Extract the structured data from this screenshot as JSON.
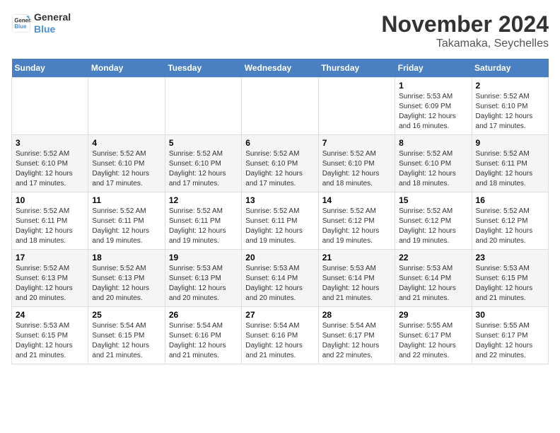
{
  "header": {
    "logo_line1": "General",
    "logo_line2": "Blue",
    "month_title": "November 2024",
    "location": "Takamaka, Seychelles"
  },
  "days_of_week": [
    "Sunday",
    "Monday",
    "Tuesday",
    "Wednesday",
    "Thursday",
    "Friday",
    "Saturday"
  ],
  "weeks": [
    [
      {
        "day": "",
        "info": ""
      },
      {
        "day": "",
        "info": ""
      },
      {
        "day": "",
        "info": ""
      },
      {
        "day": "",
        "info": ""
      },
      {
        "day": "",
        "info": ""
      },
      {
        "day": "1",
        "info": "Sunrise: 5:53 AM\nSunset: 6:09 PM\nDaylight: 12 hours and 16 minutes."
      },
      {
        "day": "2",
        "info": "Sunrise: 5:52 AM\nSunset: 6:10 PM\nDaylight: 12 hours and 17 minutes."
      }
    ],
    [
      {
        "day": "3",
        "info": "Sunrise: 5:52 AM\nSunset: 6:10 PM\nDaylight: 12 hours and 17 minutes."
      },
      {
        "day": "4",
        "info": "Sunrise: 5:52 AM\nSunset: 6:10 PM\nDaylight: 12 hours and 17 minutes."
      },
      {
        "day": "5",
        "info": "Sunrise: 5:52 AM\nSunset: 6:10 PM\nDaylight: 12 hours and 17 minutes."
      },
      {
        "day": "6",
        "info": "Sunrise: 5:52 AM\nSunset: 6:10 PM\nDaylight: 12 hours and 17 minutes."
      },
      {
        "day": "7",
        "info": "Sunrise: 5:52 AM\nSunset: 6:10 PM\nDaylight: 12 hours and 18 minutes."
      },
      {
        "day": "8",
        "info": "Sunrise: 5:52 AM\nSunset: 6:10 PM\nDaylight: 12 hours and 18 minutes."
      },
      {
        "day": "9",
        "info": "Sunrise: 5:52 AM\nSunset: 6:11 PM\nDaylight: 12 hours and 18 minutes."
      }
    ],
    [
      {
        "day": "10",
        "info": "Sunrise: 5:52 AM\nSunset: 6:11 PM\nDaylight: 12 hours and 18 minutes."
      },
      {
        "day": "11",
        "info": "Sunrise: 5:52 AM\nSunset: 6:11 PM\nDaylight: 12 hours and 19 minutes."
      },
      {
        "day": "12",
        "info": "Sunrise: 5:52 AM\nSunset: 6:11 PM\nDaylight: 12 hours and 19 minutes."
      },
      {
        "day": "13",
        "info": "Sunrise: 5:52 AM\nSunset: 6:11 PM\nDaylight: 12 hours and 19 minutes."
      },
      {
        "day": "14",
        "info": "Sunrise: 5:52 AM\nSunset: 6:12 PM\nDaylight: 12 hours and 19 minutes."
      },
      {
        "day": "15",
        "info": "Sunrise: 5:52 AM\nSunset: 6:12 PM\nDaylight: 12 hours and 19 minutes."
      },
      {
        "day": "16",
        "info": "Sunrise: 5:52 AM\nSunset: 6:12 PM\nDaylight: 12 hours and 20 minutes."
      }
    ],
    [
      {
        "day": "17",
        "info": "Sunrise: 5:52 AM\nSunset: 6:13 PM\nDaylight: 12 hours and 20 minutes."
      },
      {
        "day": "18",
        "info": "Sunrise: 5:52 AM\nSunset: 6:13 PM\nDaylight: 12 hours and 20 minutes."
      },
      {
        "day": "19",
        "info": "Sunrise: 5:53 AM\nSunset: 6:13 PM\nDaylight: 12 hours and 20 minutes."
      },
      {
        "day": "20",
        "info": "Sunrise: 5:53 AM\nSunset: 6:14 PM\nDaylight: 12 hours and 20 minutes."
      },
      {
        "day": "21",
        "info": "Sunrise: 5:53 AM\nSunset: 6:14 PM\nDaylight: 12 hours and 21 minutes."
      },
      {
        "day": "22",
        "info": "Sunrise: 5:53 AM\nSunset: 6:14 PM\nDaylight: 12 hours and 21 minutes."
      },
      {
        "day": "23",
        "info": "Sunrise: 5:53 AM\nSunset: 6:15 PM\nDaylight: 12 hours and 21 minutes."
      }
    ],
    [
      {
        "day": "24",
        "info": "Sunrise: 5:53 AM\nSunset: 6:15 PM\nDaylight: 12 hours and 21 minutes."
      },
      {
        "day": "25",
        "info": "Sunrise: 5:54 AM\nSunset: 6:15 PM\nDaylight: 12 hours and 21 minutes."
      },
      {
        "day": "26",
        "info": "Sunrise: 5:54 AM\nSunset: 6:16 PM\nDaylight: 12 hours and 21 minutes."
      },
      {
        "day": "27",
        "info": "Sunrise: 5:54 AM\nSunset: 6:16 PM\nDaylight: 12 hours and 21 minutes."
      },
      {
        "day": "28",
        "info": "Sunrise: 5:54 AM\nSunset: 6:17 PM\nDaylight: 12 hours and 22 minutes."
      },
      {
        "day": "29",
        "info": "Sunrise: 5:55 AM\nSunset: 6:17 PM\nDaylight: 12 hours and 22 minutes."
      },
      {
        "day": "30",
        "info": "Sunrise: 5:55 AM\nSunset: 6:17 PM\nDaylight: 12 hours and 22 minutes."
      }
    ]
  ]
}
